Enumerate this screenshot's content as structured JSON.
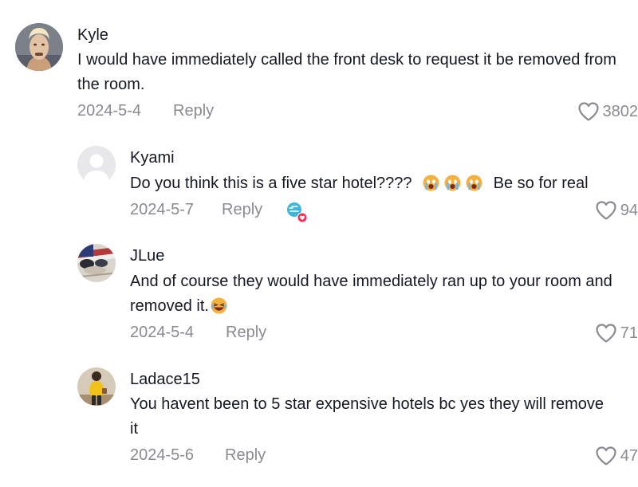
{
  "comments": [
    {
      "username": "Kyle",
      "text": "I would have immediately called the front desk to request it be removed from the room.",
      "date": "2024-5-4",
      "reply_label": "Reply",
      "likes": "3802"
    },
    {
      "username": "Kyami",
      "text_before": "Do you think this is a five star hotel????",
      "text_after": "Be so for real",
      "emoji": "crying-face",
      "date": "2024-5-7",
      "reply_label": "Reply",
      "badge_icon": "creator-liked-badge",
      "likes": "94"
    },
    {
      "username": "JLue",
      "text": "And of course they would have immediately ran up to your room and removed it.",
      "emoji": "laughing-face",
      "date": "2024-5-4",
      "reply_label": "Reply",
      "likes": "71"
    },
    {
      "username": "Ladace15",
      "text": "You havent been to 5 star expensive hotels bc yes they will remove it",
      "date": "2024-5-6",
      "reply_label": "Reply",
      "likes": "47"
    }
  ],
  "colors": {
    "primary_text": "#161823",
    "secondary_text": "#8a8b91"
  }
}
